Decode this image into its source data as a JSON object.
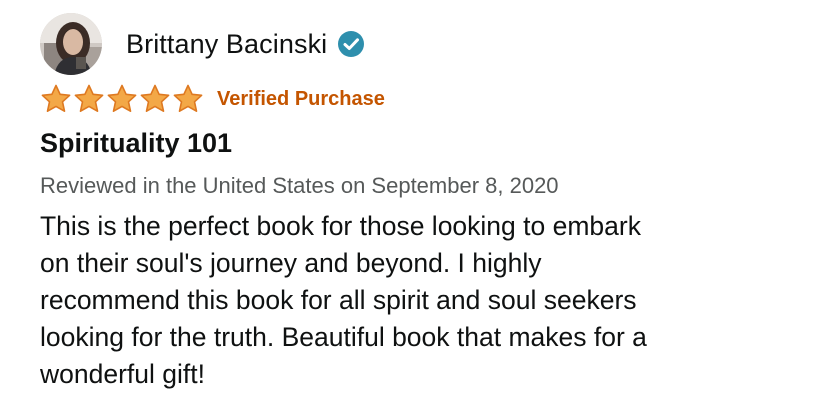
{
  "review": {
    "reviewer_name": "Brittany Bacinski",
    "rating": 5,
    "rating_max": 5,
    "verified_label": "Verified Purchase",
    "title": "Spirituality 101",
    "date_line": "Reviewed in the United States on September 8, 2020",
    "body_lines": [
      "This is the perfect book for those looking to embark",
      "on their soul's journey and beyond. I highly",
      "recommend this book for all spirit and soul seekers",
      "looking for the truth. Beautiful book that makes for a",
      "wonderful gift!"
    ],
    "icons": {
      "avatar": "user-avatar-photo",
      "badge": "verified-check-icon",
      "star": "star-icon"
    }
  },
  "colors": {
    "star": "#f3a847",
    "star_stroke": "#de7921",
    "verified_text": "#c45500",
    "badge": "#2e8fad",
    "date_text": "#565959",
    "body_text": "#0f1111"
  }
}
